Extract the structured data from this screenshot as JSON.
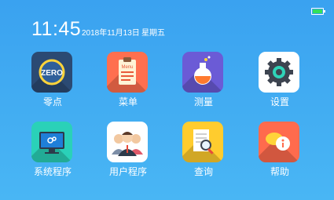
{
  "status": {
    "time": "11:45",
    "date": "2018年11月13日",
    "weekday": "星期五",
    "battery_icon": "battery-icon",
    "battery_color": "#33e05a"
  },
  "apps": [
    {
      "label": "零点",
      "icon": "zero-icon",
      "badge": "ZERO",
      "color": "#2b4a73"
    },
    {
      "label": "菜单",
      "icon": "menu-clipboard-icon",
      "badge": "Menu",
      "color": "#ff6f4f"
    },
    {
      "label": "测量",
      "icon": "flask-icon",
      "color": "#6b5bd6"
    },
    {
      "label": "设置",
      "icon": "gear-icon",
      "color": "#ffffff"
    },
    {
      "label": "系统程序",
      "icon": "system-monitor-icon",
      "color": "#2ad1b8"
    },
    {
      "label": "用户程序",
      "icon": "users-icon",
      "color": "#ffffff"
    },
    {
      "label": "查询",
      "icon": "search-document-icon",
      "color": "#ffcc2e"
    },
    {
      "label": "帮助",
      "icon": "help-chat-icon",
      "color": "#ff6b4d"
    }
  ]
}
